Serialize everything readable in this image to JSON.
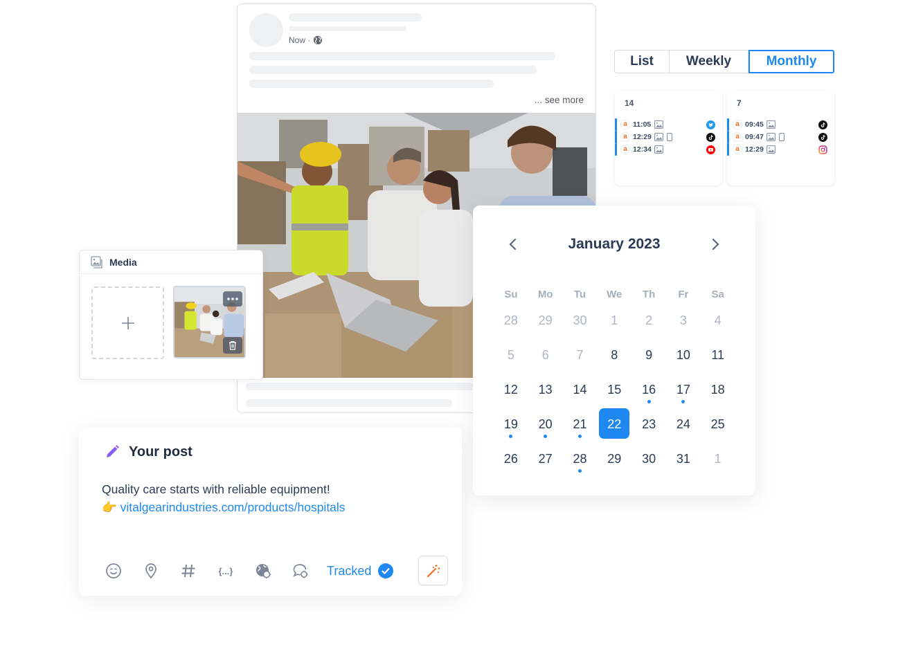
{
  "post_preview": {
    "timestamp": "Now ·",
    "visibility_icon": "globe-icon",
    "see_more": "... see more"
  },
  "view_toggle": {
    "options": [
      "List",
      "Weekly",
      "Monthly"
    ],
    "selected": "Monthly"
  },
  "day_cards": [
    {
      "day": "14",
      "posts": [
        {
          "account_badge": "a",
          "time": "11:05",
          "media": "image",
          "mobile": false,
          "network": "twitter"
        },
        {
          "account_badge": "a",
          "time": "12:29",
          "media": "image",
          "mobile": true,
          "network": "tiktok"
        },
        {
          "account_badge": "a",
          "time": "12:34",
          "media": "image",
          "mobile": false,
          "network": "youtube"
        }
      ]
    },
    {
      "day": "7",
      "posts": [
        {
          "account_badge": "a",
          "time": "09:45",
          "media": "image",
          "mobile": false,
          "network": "tiktok"
        },
        {
          "account_badge": "a",
          "time": "09:47",
          "media": "image",
          "mobile": true,
          "network": "tiktok"
        },
        {
          "account_badge": "a",
          "time": "12:29",
          "media": "image",
          "mobile": false,
          "network": "instagram"
        }
      ]
    }
  ],
  "datepicker": {
    "title": "January 2023",
    "weekdays": [
      "Su",
      "Mo",
      "Tu",
      "We",
      "Th",
      "Fr",
      "Sa"
    ],
    "weeks": [
      [
        {
          "d": "28",
          "muted": true
        },
        {
          "d": "29",
          "muted": true
        },
        {
          "d": "30",
          "muted": true
        },
        {
          "d": "1",
          "muted": true
        },
        {
          "d": "2",
          "muted": true
        },
        {
          "d": "3",
          "muted": true
        },
        {
          "d": "4",
          "muted": true
        }
      ],
      [
        {
          "d": "5",
          "muted": true
        },
        {
          "d": "6",
          "muted": true
        },
        {
          "d": "7",
          "muted": true
        },
        {
          "d": "8"
        },
        {
          "d": "9"
        },
        {
          "d": "10"
        },
        {
          "d": "11"
        }
      ],
      [
        {
          "d": "12"
        },
        {
          "d": "13"
        },
        {
          "d": "14"
        },
        {
          "d": "15"
        },
        {
          "d": "16",
          "dot": true
        },
        {
          "d": "17",
          "dot": true
        },
        {
          "d": "18"
        }
      ],
      [
        {
          "d": "19",
          "dot": true
        },
        {
          "d": "20",
          "dot": true
        },
        {
          "d": "21",
          "dot": true
        },
        {
          "d": "22",
          "selected": true
        },
        {
          "d": "23"
        },
        {
          "d": "24"
        },
        {
          "d": "25"
        }
      ],
      [
        {
          "d": "26"
        },
        {
          "d": "27"
        },
        {
          "d": "28",
          "dot": true
        },
        {
          "d": "29"
        },
        {
          "d": "30"
        },
        {
          "d": "31"
        },
        {
          "d": "1",
          "muted": true
        }
      ]
    ],
    "selected_date": "22"
  },
  "media": {
    "title": "Media",
    "add_label": "+"
  },
  "composer": {
    "title": "Your post",
    "text": "Quality care starts with reliable equipment!",
    "link_emoji": "👉",
    "link": "vitalgearindustries.com/products/hospitals",
    "tools": [
      "emoji-icon",
      "location-icon",
      "hashtag-icon",
      "variables-icon",
      "globe-targeting-icon",
      "comment-targeting-icon"
    ],
    "variables_label": "{...}",
    "tracked_label": "Tracked",
    "tracked": true
  },
  "colors": {
    "accent": "#1e88f0",
    "text_dark": "#2b3a55",
    "muted": "#aeb4c0",
    "account_badge": "#f36e20",
    "pencil": "#8b5cf6"
  }
}
